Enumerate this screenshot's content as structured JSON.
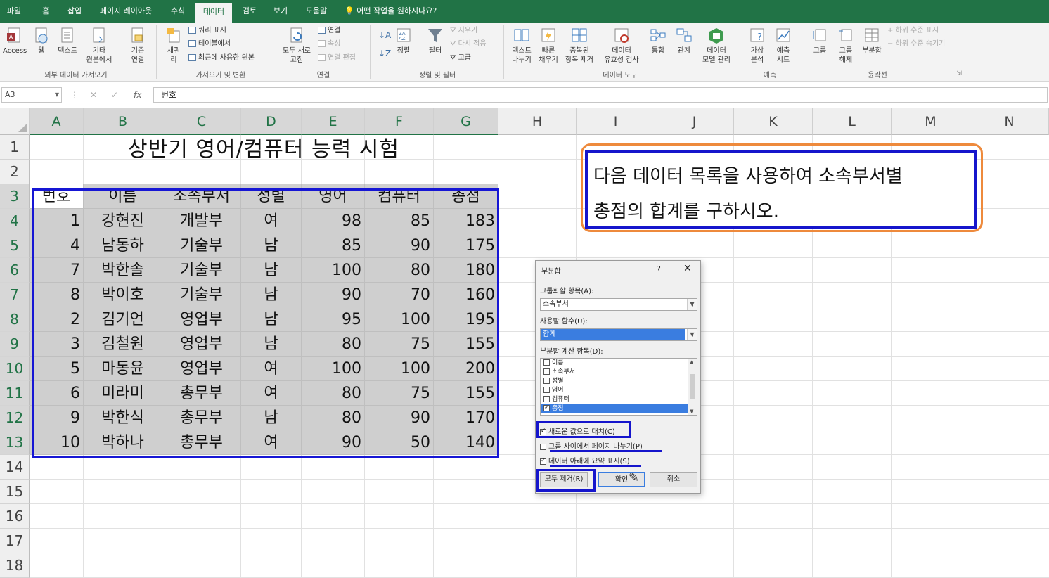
{
  "ribbon_tabs": [
    "파일",
    "홈",
    "삽입",
    "페이지 레이아웃",
    "수식",
    "데이터",
    "검토",
    "보기",
    "도움말"
  ],
  "active_tab": "데이터",
  "tell_me": "어떤 작업을 원하시나요?",
  "ribbon": {
    "get_external": {
      "access": "Access",
      "web": "웹",
      "text": "텍스트",
      "other_1": "기타",
      "other_2": "원본에서",
      "existing_1": "기존",
      "existing_2": "연결",
      "group_label": "외부 데이터 가져오기"
    },
    "transform": {
      "new_query_1": "새쿼",
      "new_query_2": "리",
      "show_query": "쿼리 표시",
      "from_table": "테이블에서",
      "recent_sources": "최근에 사용한 원본",
      "group_label": "가져오기 및 변환"
    },
    "connections": {
      "refresh_1": "모두 새로",
      "refresh_2": "고침",
      "connections": "연결",
      "properties": "속성",
      "edit_links": "연결 편집",
      "group_label": "연결"
    },
    "sort_filter": {
      "sort": "정렬",
      "filter": "필터",
      "clear": "지우기",
      "reapply": "다시 적용",
      "advanced": "고급",
      "group_label": "정렬 및 필터"
    },
    "data_tools": {
      "text_to_columns_1": "텍스트",
      "text_to_columns_2": "나누기",
      "flash_fill_1": "빠른",
      "flash_fill_2": "채우기",
      "remove_dup_1": "중복된",
      "remove_dup_2": "항목 제거",
      "validation_1": "데이터",
      "validation_2": "유효성 검사",
      "consolidate": "통합",
      "relationships": "관계",
      "data_model_1": "데이터",
      "data_model_2": "모델 관리",
      "group_label": "데이터 도구"
    },
    "forecast": {
      "whatif_1": "가상",
      "whatif_2": "분석",
      "sheet_1": "예측",
      "sheet_2": "시트",
      "group_label": "예측"
    },
    "outline": {
      "group": "그룹",
      "ungroup_1": "그룹",
      "ungroup_2": "해제",
      "subtotal": "부분합",
      "show_detail": "하위 수준 표시",
      "hide_detail": "하위 수준 숨기기",
      "group_label": "윤곽선"
    }
  },
  "formula_bar": {
    "name_box": "A3",
    "content": "번호"
  },
  "columns": [
    "A",
    "B",
    "C",
    "D",
    "E",
    "F",
    "G",
    "H",
    "I",
    "J",
    "K",
    "L",
    "M",
    "N"
  ],
  "rows": [
    "1",
    "2",
    "3",
    "4",
    "5",
    "6",
    "7",
    "8",
    "9",
    "10",
    "11",
    "12",
    "13",
    "14",
    "15",
    "16",
    "17",
    "18"
  ],
  "sheet": {
    "title": "상반기 영어/컴퓨터 능력 시험",
    "headers": [
      "번호",
      "이름",
      "소속부서",
      "성별",
      "영어",
      "컴퓨터",
      "총점"
    ],
    "records": [
      [
        "1",
        "강현진",
        "개발부",
        "여",
        "98",
        "85",
        "183"
      ],
      [
        "4",
        "남동하",
        "기술부",
        "남",
        "85",
        "90",
        "175"
      ],
      [
        "7",
        "박한솔",
        "기술부",
        "남",
        "100",
        "80",
        "180"
      ],
      [
        "8",
        "박이호",
        "기술부",
        "남",
        "90",
        "70",
        "160"
      ],
      [
        "2",
        "김기언",
        "영업부",
        "남",
        "95",
        "100",
        "195"
      ],
      [
        "3",
        "김철원",
        "영업부",
        "남",
        "80",
        "75",
        "155"
      ],
      [
        "5",
        "마동윤",
        "영업부",
        "여",
        "100",
        "100",
        "200"
      ],
      [
        "6",
        "미라미",
        "총무부",
        "여",
        "80",
        "75",
        "155"
      ],
      [
        "9",
        "박한식",
        "총무부",
        "남",
        "80",
        "90",
        "170"
      ],
      [
        "10",
        "박하나",
        "총무부",
        "여",
        "90",
        "50",
        "140"
      ]
    ]
  },
  "instruction": {
    "line1": "다음 데이터 목록을 사용하여 소속부서별",
    "line2": "총점의 합계를 구하시오."
  },
  "dialog": {
    "title": "부분합",
    "help": "?",
    "close": "✕",
    "group_by_label": "그룹화할 항목(A):",
    "group_by_value": "소속부서",
    "function_label": "사용할 함수(U):",
    "function_value": "합계",
    "add_to_label": "부분합 계산 항목(D):",
    "fields": [
      {
        "label": "이름",
        "checked": false
      },
      {
        "label": "소속부서",
        "checked": false
      },
      {
        "label": "성별",
        "checked": false
      },
      {
        "label": "영어",
        "checked": false
      },
      {
        "label": "컴퓨터",
        "checked": false
      },
      {
        "label": "총점",
        "checked": true
      }
    ],
    "replace_current": "새로운 값으로 대치(C)",
    "page_break": "그룹 사이에서 페이지 나누기(P)",
    "summary_below": "데이터 아래에 요약 표시(S)",
    "remove_all": "모두 제거(R)",
    "ok": "확인",
    "cancel": "취소"
  },
  "colors": {
    "excel_green": "#217346",
    "annotation_blue": "#1515cc",
    "annotation_orange": "#ee8a3c",
    "selection_blue": "#3a7de0"
  }
}
